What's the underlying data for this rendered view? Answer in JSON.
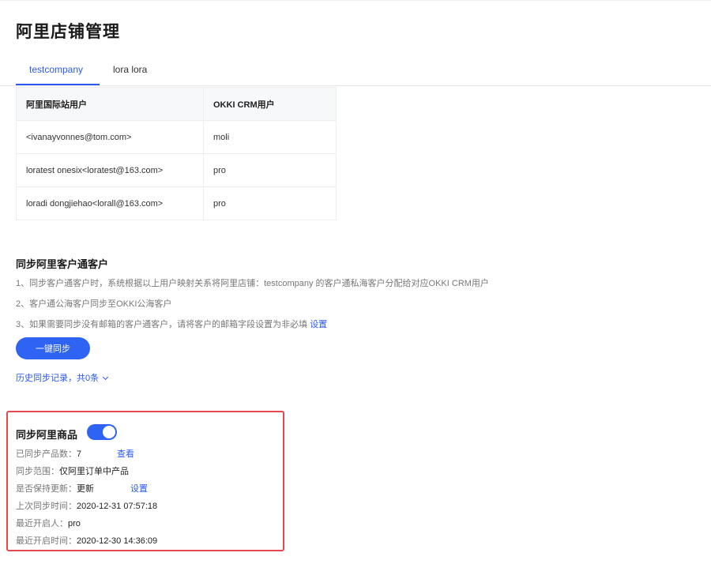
{
  "page": {
    "title": "阿里店铺管理"
  },
  "tabs": [
    {
      "label": "testcompany",
      "active": true
    },
    {
      "label": "lora lora",
      "active": false
    }
  ],
  "mapping_table": {
    "headers": [
      "阿里国际站用户",
      "OKKI CRM用户"
    ],
    "rows": [
      [
        "<ivanayvonnes@tom.com>",
        "moli"
      ],
      [
        "loratest onesix<loratest@163.com>",
        "pro"
      ],
      [
        "loradi dongjiehao<lorall@163.com>",
        "pro"
      ]
    ]
  },
  "customer_sync": {
    "title": "同步阿里客户通客户",
    "rule1": "1、同步客户通客户时，系统根据以上用户映射关系将阿里店铺：testcompany 的客户通私海客户分配给对应OKKI CRM用户",
    "rule2": "2、客户通公海客户同步至OKKI公海客户",
    "rule3": "3、如果需要同步没有邮箱的客户通客户，请将客户的邮箱字段设置为非必填",
    "rule3_link": "设置",
    "button_label": "一键同步",
    "history_label": "历史同步记录，共0条"
  },
  "product_sync": {
    "title": "同步阿里商品",
    "toggle_on": true,
    "synced_count_label": "已同步产品数：",
    "synced_count": "7",
    "view_link": "查看",
    "scope_label": "同步范围：",
    "scope_value": "仅阿里订单中产品",
    "keep_update_label": "是否保持更新：",
    "keep_update_value": "更新",
    "settings_link": "设置",
    "last_sync_label": "上次同步时间：",
    "last_sync_value": "2020-12-31 07:57:18",
    "recent_enabler_label": "最近开启人：",
    "recent_enabler_value": "pro",
    "recent_enable_time_label": "最近开启时间：",
    "recent_enable_time_value": "2020-12-30 14:36:09"
  },
  "colors": {
    "accent": "#2f63f4",
    "highlight": "#e5484d"
  }
}
